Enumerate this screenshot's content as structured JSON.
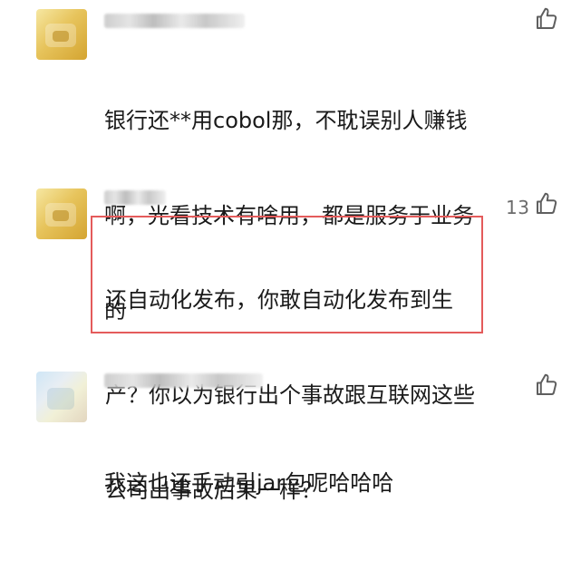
{
  "comments": [
    {
      "like_count": "",
      "text_lines": [
        "银行还**用cobol那，不耽误别人赚钱",
        "啊，光看技术有啥用，都是服务于业务",
        "的"
      ]
    },
    {
      "like_count": "13",
      "text_lines": [
        "还自动化发布，你敢自动化发布到生",
        "产？你以为银行出个事故跟互联网这些",
        "公司出事故后果一样？"
      ]
    },
    {
      "like_count": "",
      "text_lines": [
        "我这也还手动引jar包呢哈哈哈"
      ]
    }
  ],
  "icons": {
    "like": "thumbs-up-icon"
  },
  "colors": {
    "highlight": "#e45b5b",
    "icon_gray": "#5f5f5f",
    "text": "#1a1a1a"
  }
}
